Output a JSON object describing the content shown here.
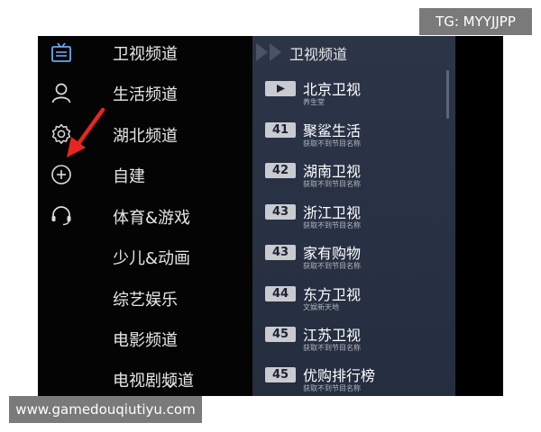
{
  "categories": [
    "卫视频道",
    "生活频道",
    "湖北频道",
    "自建",
    "体育&游戏",
    "少儿&动画",
    "综艺娱乐",
    "电影频道",
    "电视剧频道"
  ],
  "icons": [
    "tv-icon",
    "user-icon",
    "gear-icon",
    "add-circle-icon",
    "headset-icon"
  ],
  "panel": {
    "title": "卫视频道"
  },
  "channels": [
    {
      "badge": "",
      "badge_icon": "play-icon",
      "name": "北京卫视",
      "program": "养生堂"
    },
    {
      "badge": "41",
      "name": "聚鲨生活",
      "program": "获取不到节目名称"
    },
    {
      "badge": "42",
      "name": "湖南卫视",
      "program": "获取不到节目名称"
    },
    {
      "badge": "43",
      "name": "浙江卫视",
      "program": "获取不到节目名称"
    },
    {
      "badge": "43",
      "name": "家有购物",
      "program": "获取不到节目名称"
    },
    {
      "badge": "44",
      "name": "东方卫视",
      "program": "文娱新天地"
    },
    {
      "badge": "45",
      "name": "江苏卫视",
      "program": "获取不到节目名称"
    },
    {
      "badge": "45",
      "name": "优购排行榜",
      "program": "获取不到节目名称"
    }
  ],
  "watermarks": {
    "top": "TG: MYYJJPP",
    "bottom": "www.gamedouqiutiyu.com"
  },
  "colors": {
    "screen_bg": "#040404",
    "panel_bg": "#2a3346",
    "badge_bg": "#c9cbd0",
    "accent_blue": "#6aa8f0",
    "annotation_red": "#e8251f"
  }
}
